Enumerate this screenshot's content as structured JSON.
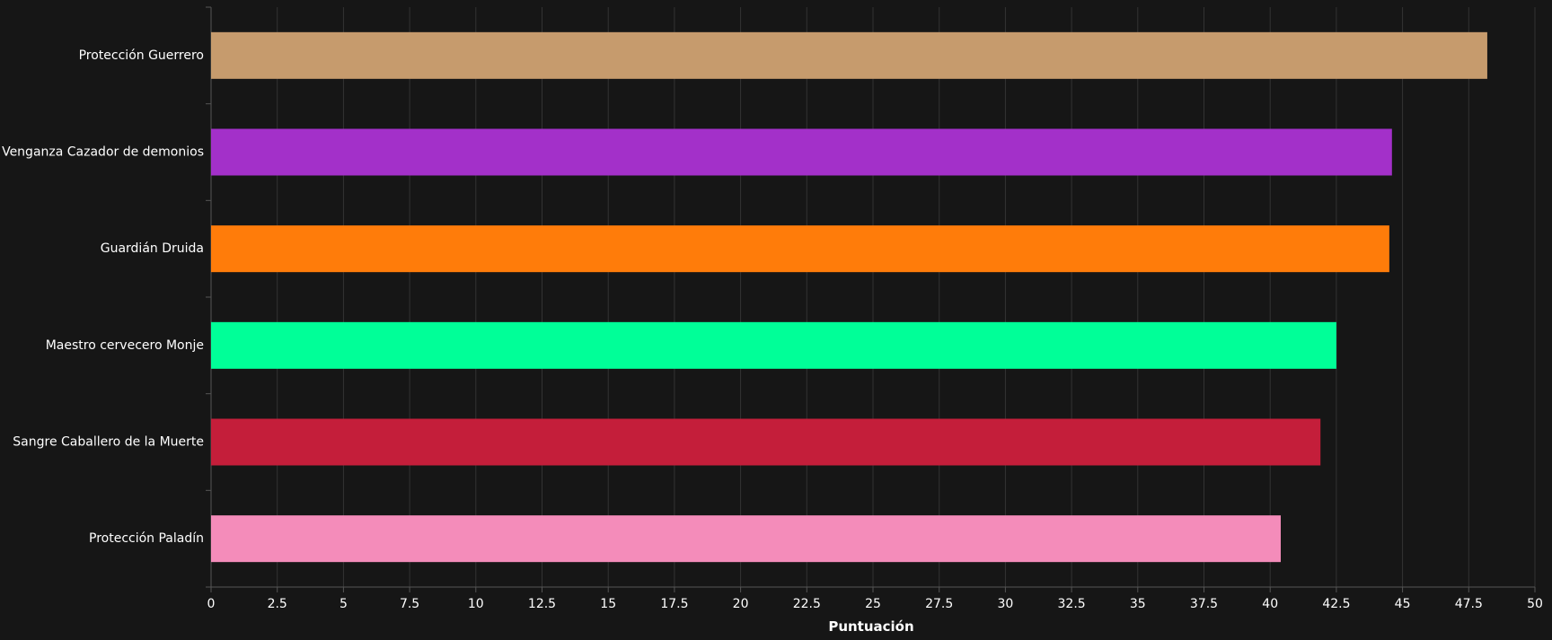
{
  "chart_data": {
    "type": "bar",
    "orientation": "horizontal",
    "title": "",
    "xlabel": "Puntuación",
    "ylabel": "",
    "xlim": [
      0,
      50
    ],
    "x_ticks": [
      0,
      2.5,
      5,
      7.5,
      10,
      12.5,
      15,
      17.5,
      20,
      22.5,
      25,
      27.5,
      30,
      32.5,
      35,
      37.5,
      40,
      42.5,
      45,
      47.5,
      50
    ],
    "x_tick_labels": [
      "0",
      "2.5",
      "5",
      "7.5",
      "10",
      "12.5",
      "15",
      "17.5",
      "20",
      "22.5",
      "25",
      "27.5",
      "30",
      "32.5",
      "35",
      "37.5",
      "40",
      "42.5",
      "45",
      "47.5",
      "50"
    ],
    "grid": "vertical",
    "legend": "none",
    "categories": [
      "Protección Guerrero",
      "Venganza Cazador de demonios",
      "Guardián Druida",
      "Maestro cervecero Monje",
      "Sangre Caballero de la Muerte",
      "Protección Paladín"
    ],
    "values": [
      48.2,
      44.6,
      44.5,
      42.5,
      41.9,
      40.4
    ],
    "colors": [
      "#C69B6D",
      "#A330C9",
      "#FF7C0A",
      "#00FF98",
      "#C41E3A",
      "#F48CBA"
    ]
  },
  "theme": {
    "background": "#161616",
    "text": "#ffffff",
    "grid": "#333333",
    "axis": "#555555"
  }
}
